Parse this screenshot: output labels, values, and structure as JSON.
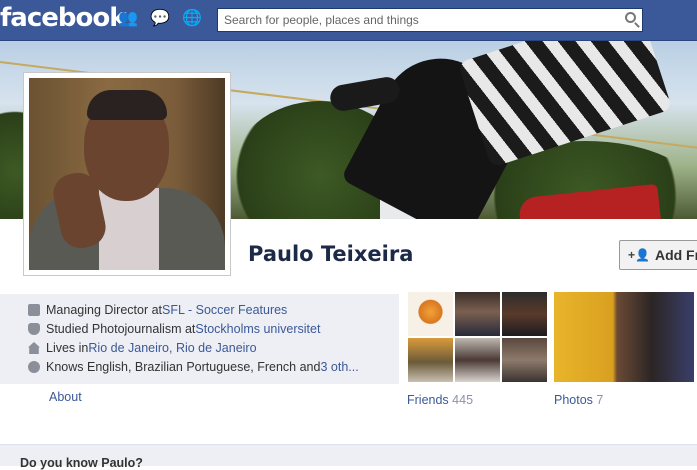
{
  "header": {
    "logo": "facebook",
    "icons": [
      "friend-requests-icon",
      "messages-icon",
      "notifications-icon"
    ],
    "search_placeholder": "Search for people, places and things"
  },
  "profile": {
    "name": "Paulo Teixeira",
    "add_friend_label": "Add Fr",
    "info": [
      {
        "icon": "briefcase-icon",
        "prefix": "Managing Director at ",
        "link": "SFL - Soccer Features",
        "suffix": ""
      },
      {
        "icon": "graduation-icon",
        "prefix": "Studied Photojournalism at ",
        "link": "Stockholms universitet",
        "suffix": ""
      },
      {
        "icon": "house-icon",
        "prefix": "Lives in ",
        "link": "Rio de Janeiro, Rio de Janeiro",
        "suffix": ""
      },
      {
        "icon": "globe-icon",
        "prefix": "Knows English, Brazilian Portuguese, French and ",
        "link": "3 oth...",
        "suffix": ""
      }
    ],
    "about_label": "About",
    "friends_label": "Friends",
    "friends_count": "445",
    "photos_label": "Photos",
    "photos_count": "7"
  },
  "bottom": {
    "prompt": "Do you know Paulo?"
  },
  "colors": {
    "brand_blue": "#3b5998",
    "info_bg": "#edeff4",
    "name_color": "#1c2a47"
  }
}
